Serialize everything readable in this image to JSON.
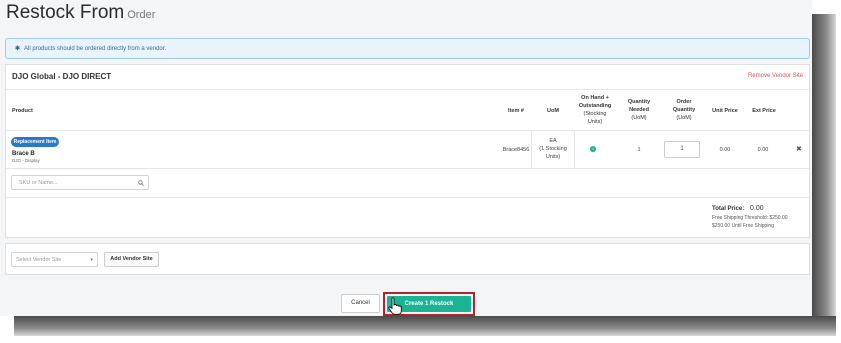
{
  "page": {
    "title": "Restock From",
    "subtitle": "Order"
  },
  "alert": {
    "icon": "info-icon",
    "text": "All products should be ordered directly from a vendor."
  },
  "vendor": {
    "name": "DJO Global - DJO DIRECT",
    "remove_label": "Remove Vendor Site"
  },
  "table": {
    "headers": {
      "product": "Product",
      "item": "Item #",
      "uom": "UoM",
      "on_hand_l1": "On Hand +",
      "on_hand_l2": "Outstanding",
      "on_hand_l3": "(Stocking",
      "on_hand_l4": "Units)",
      "qty_needed_l1": "Quantity",
      "qty_needed_l2": "Needed",
      "qty_needed_l3": "(UoM)",
      "order_qty_l1": "Order",
      "order_qty_l2": "Quantity",
      "order_qty_l3": "(UoM)",
      "unit_price": "Unit Price",
      "ext_price": "Ext Price"
    },
    "rows": [
      {
        "badge": "Replacement Item",
        "name": "Brace B",
        "desc": "DJO - Display",
        "item": "Brace8456",
        "uom_l1": "EA",
        "uom_l2": "(1 Stocking",
        "uom_l3": "Units)",
        "on_hand_icon": "info-circle-icon",
        "qty_needed": "1",
        "order_qty": "1",
        "unit_price": "0.00",
        "ext_price": "0.00"
      }
    ]
  },
  "search": {
    "placeholder": "SKU or Name..."
  },
  "totals": {
    "label": "Total Price:",
    "value": "0.00",
    "shipping_threshold": "Free Shipping Threshold: $250.00",
    "until_free": "$250.00 Until Free Shipping"
  },
  "vendor_select": {
    "placeholder": "Select Vendor Site",
    "add_label": "Add Vendor Site"
  },
  "actions": {
    "cancel": "Cancel",
    "create": "Create 1 Restock"
  },
  "colors": {
    "primary": "#1ab394",
    "badge": "#2a78c8",
    "danger": "#e05656",
    "alert_bg": "#e8f3fb",
    "highlight": "#b3232f"
  }
}
